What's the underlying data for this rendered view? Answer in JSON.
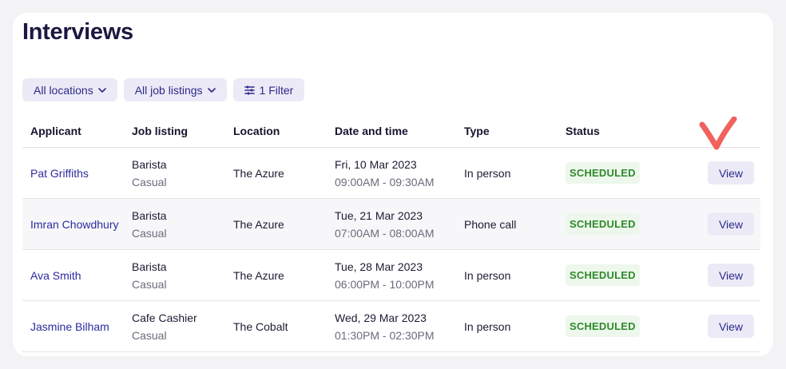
{
  "page": {
    "title": "Interviews"
  },
  "filters": {
    "locations": "All locations",
    "job_listings": "All job listings",
    "filter": "1 Filter"
  },
  "table": {
    "headers": [
      "Applicant",
      "Job listing",
      "Location",
      "Date and time",
      "Type",
      "Status"
    ],
    "rows": [
      {
        "applicant": "Pat Griffiths",
        "job": "Barista",
        "job_type": "Casual",
        "location": "The Azure",
        "date": "Fri, 10 Mar 2023",
        "time": "09:00AM - 09:30AM",
        "type": "In person",
        "status": "SCHEDULED",
        "action": "View"
      },
      {
        "applicant": "Imran Chowdhury",
        "job": "Barista",
        "job_type": "Casual",
        "location": "The Azure",
        "date": "Tue, 21 Mar 2023",
        "time": "07:00AM - 08:00AM",
        "type": "Phone call",
        "status": "SCHEDULED",
        "action": "View"
      },
      {
        "applicant": "Ava Smith",
        "job": "Barista",
        "job_type": "Casual",
        "location": "The Azure",
        "date": "Tue, 28 Mar 2023",
        "time": "06:00PM - 10:00PM",
        "type": "In person",
        "status": "SCHEDULED",
        "action": "View"
      },
      {
        "applicant": "Jasmine Bilham",
        "job": "Cafe Cashier",
        "job_type": "Casual",
        "location": "The Cobalt",
        "date": "Wed, 29 Mar 2023",
        "time": "01:30PM - 02:30PM",
        "type": "In person",
        "status": "SCHEDULED",
        "action": "View"
      }
    ]
  },
  "icons": {
    "chevron": "chevron-down-icon",
    "filter": "sliders-icon",
    "annotation": "checkmark-icon"
  },
  "colors": {
    "accent": "#2d2a8a",
    "chip_bg": "#ebeaf6",
    "status_text": "#2f8a2b",
    "status_bg": "#edf7ec",
    "annotation": "#f0625d"
  }
}
